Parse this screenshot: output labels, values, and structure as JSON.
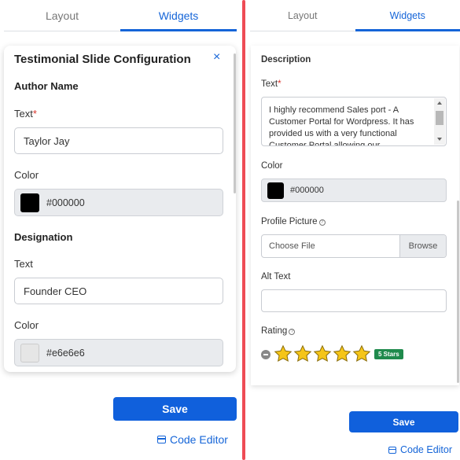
{
  "left": {
    "tabs": [
      {
        "label": "Layout"
      },
      {
        "label": "Widgets"
      }
    ],
    "card": {
      "title": "Testimonial Slide Configuration",
      "close_symbol": "×",
      "author_heading": "Author Name",
      "author_text_label": "Text",
      "required_mark": "*",
      "author_text_value": "Taylor Jay",
      "author_color_label": "Color",
      "author_color_value": "#000000",
      "designation_heading": "Designation",
      "designation_text_label": "Text",
      "designation_text_value": "Founder CEO",
      "designation_color_label": "Color",
      "designation_color_value": "#e6e6e6"
    },
    "save_label": "Save",
    "code_editor_label": "Code Editor"
  },
  "right": {
    "tabs": [
      {
        "label": "Layout"
      },
      {
        "label": "Widgets"
      }
    ],
    "description_heading": "Description",
    "text_label": "Text",
    "required_mark": "*",
    "description_text": "I highly recommend Sales port - A Customer Portal for Wordpress. It has provided us with a very functional Customer Portal allowing our",
    "color_label": "Color",
    "color_value": "#000000",
    "profile_picture_label": "Profile Picture",
    "info_symbol": "?",
    "choose_file_placeholder": "Choose File",
    "browse_label": "Browse",
    "alt_text_label": "Alt Text",
    "alt_text_value": "",
    "rating_label": "Rating",
    "rating_value": 5,
    "rating_max": 5,
    "rating_badge": "5 Stars",
    "save_label": "Save",
    "code_editor_label": "Code Editor"
  },
  "colors": {
    "accent": "#1565d8",
    "divider": "#ee4b55",
    "badge": "#1f8a4c",
    "star": "#f5c518",
    "author_swatch": "#000000",
    "designation_swatch": "#e6e6e6"
  }
}
